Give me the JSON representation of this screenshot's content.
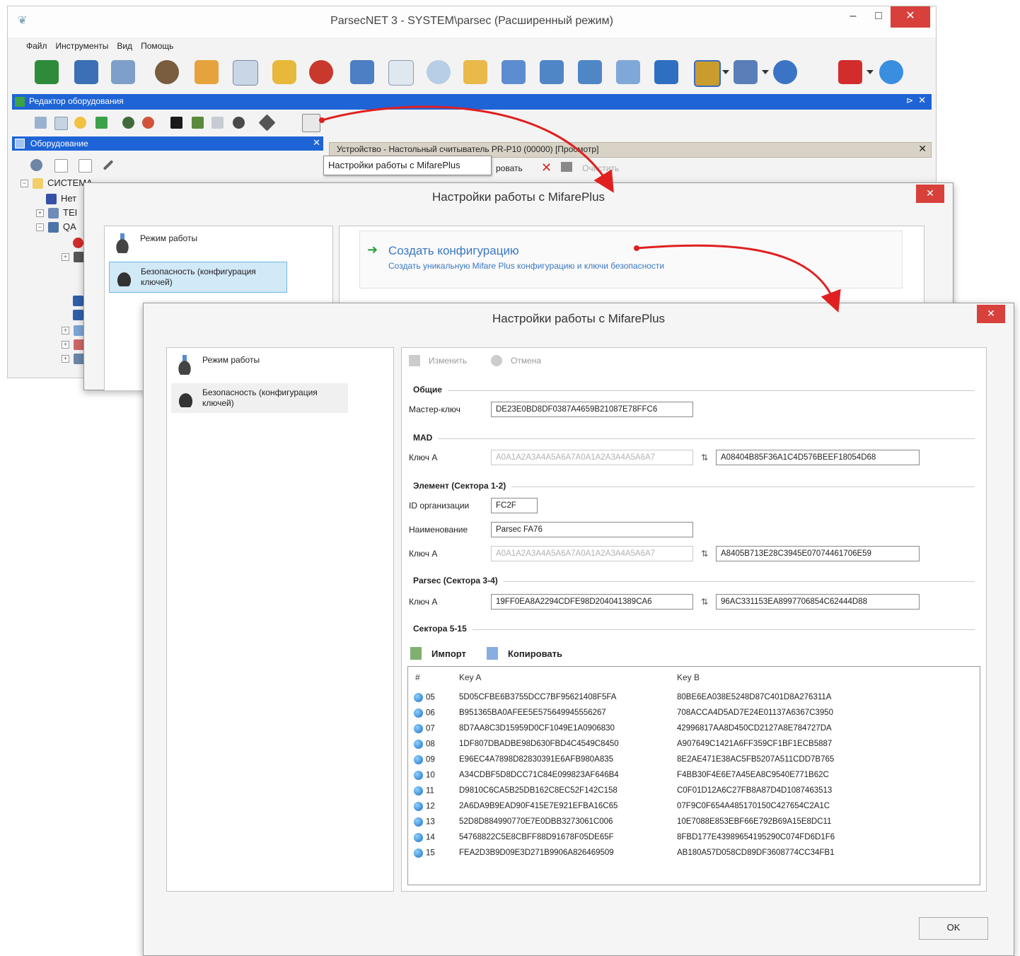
{
  "main_window": {
    "title": "ParsecNET 3 - SYSTEM\\parsec (Расширенный режим)",
    "controls": {
      "minimize": "–",
      "maximize": "□",
      "close": "✕"
    },
    "menu": [
      "Файл",
      "Инструменты",
      "Вид",
      "Помощь"
    ],
    "editor_panel_title": "Редактор оборудования",
    "editor_panel_pin": "⊳",
    "editor_panel_close": "✕",
    "hardware_panel_title": "Оборудование",
    "hardware_panel_close": "✕",
    "tree": [
      {
        "label": "СИСТЕМА"
      },
      {
        "label": "Нет"
      },
      {
        "label": "TEI"
      },
      {
        "label": "QA"
      }
    ],
    "device_tab_title": "Устройство - Настольный считыватель PR-P10 (00000) [Просмотр]",
    "device_tab_close": "✕",
    "tooltip": "Настройки работы с MifarePlus",
    "device_tools": {
      "save_label": "ровать",
      "delete_label": "✕",
      "clear_label": "Очистить"
    },
    "colors": {
      "panel_blue": "#1e64d6",
      "close_red": "#d8413b",
      "arrow_red": "#e02020"
    }
  },
  "dialog_back": {
    "title": "Настройки работы с MifarePlus",
    "close": "✕",
    "nav": [
      {
        "label": "Режим работы",
        "icon": "reader-icon"
      },
      {
        "label": "Безопасность (конфигурация ключей)",
        "icon": "security-card-icon"
      }
    ],
    "create": {
      "title": "Создать конфигурацию",
      "description": "Создать уникальную Mifare Plus конфигурацию и ключи безопасности"
    }
  },
  "dialog_front": {
    "title": "Настройки работы с MifarePlus",
    "close": "✕",
    "nav": [
      {
        "label": "Режим работы",
        "icon": "reader-icon"
      },
      {
        "label": "Безопасность (конфигурация ключей)",
        "icon": "security-card-icon"
      }
    ],
    "toolbar": {
      "edit": "Изменить",
      "cancel": "Отмена"
    },
    "general": {
      "section": "Общие",
      "master_key_label": "Мастер-ключ",
      "master_key": "DE23E0BD8DF0387A4659B21087E78FFC6"
    },
    "mad": {
      "section": "MAD",
      "key_label": "Ключ A",
      "key_a": "A0A1A2A3A4A5A6A7A0A1A2A3A4A5A6A7",
      "key_b": "A08404B85F36A1C4D576BEEF18054D68"
    },
    "element": {
      "section": "Элемент (Сектора 1-2)",
      "org_id_label": "ID организации",
      "org_id": "FC2F",
      "name_label": "Наименование",
      "name": "Parsec FA76",
      "key_label": "Ключ A",
      "key_a": "A0A1A2A3A4A5A6A7A0A1A2A3A4A5A6A7",
      "key_b": "A8405B713E28C3945E07074461706E59"
    },
    "parsec": {
      "section": "Parsec (Сектора 3-4)",
      "key_label": "Ключ A",
      "key_a": "19FF0EA8A2294CDFE98D204041389CA6",
      "key_b": "96AC331153EA8997706854C62444D88"
    },
    "sectors": {
      "section": "Сектора 5-15",
      "import_label": "Импорт",
      "copy_label": "Копировать",
      "columns": [
        "#",
        "Key A",
        "Key B"
      ],
      "rows": [
        {
          "n": "05",
          "a": "5D05CFBE6B3755DCC7BF95621408F5FA",
          "b": "80BE6EA038E5248D87C401D8A276311A"
        },
        {
          "n": "06",
          "a": "B951365BA0AFEE5E575649945556267",
          "b": "708ACCA4D5AD7E24E01137A6367C3950"
        },
        {
          "n": "07",
          "a": "8D7AA8C3D15959D0CF1049E1A0906830",
          "b": "42996817AA8D450CD2127A8E784727DA"
        },
        {
          "n": "08",
          "a": "1DF807DBADBE98D630FBD4C4549C8450",
          "b": "A907649C1421A6FF359CF1BF1ECB5887"
        },
        {
          "n": "09",
          "a": "E96EC4A7898D82830391E6AFB980A835",
          "b": "8E2AE471E38AC5FB5207A511CDD7B765"
        },
        {
          "n": "10",
          "a": "A34CDBF5D8DCC71C84E099823AF646B4",
          "b": "F4BB30F4E6E7A45EA8C9540E771B62C"
        },
        {
          "n": "11",
          "a": "D9810C6CA5B25DB162C8EC52F142C158",
          "b": "C0F01D12A6C27FB8A87D4D1087463513"
        },
        {
          "n": "12",
          "a": "2A6DA9B9EAD90F415E7E921EFBA16C65",
          "b": "07F9C0F654A485170150C427654C2A1C"
        },
        {
          "n": "13",
          "a": "52D8D884990770E7E0DBB3273061C006",
          "b": "10E7088E853EBF66E792B69A15E8DC11"
        },
        {
          "n": "14",
          "a": "54768822C5E8CBFF88D91678F05DE65F",
          "b": "8FBD177E43989654195290C074FD6D1F6"
        },
        {
          "n": "15",
          "a": "FEA2D3B9D09E3D271B9906A826469509",
          "b": "AB180A57D058CD89DF3608774CC34FB1"
        }
      ]
    },
    "ok_label": "OK"
  }
}
